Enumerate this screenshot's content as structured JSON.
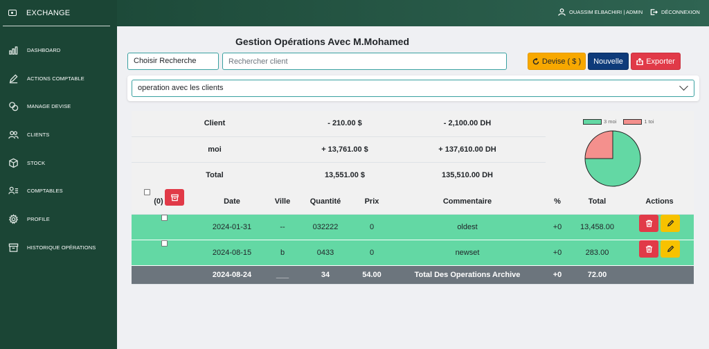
{
  "brand": {
    "title": "EXCHANGE"
  },
  "sidebar": {
    "items": [
      {
        "label": "DASHBOARD",
        "icon": "bar-chart-icon"
      },
      {
        "label": "ACTIONS COMPTABLE",
        "icon": "pencil-icon"
      },
      {
        "label": "MANAGE DEVISE",
        "icon": "coins-icon"
      },
      {
        "label": "CLIENTS",
        "icon": "users-icon"
      },
      {
        "label": "STOCK",
        "icon": "box-icon"
      },
      {
        "label": "COMPTABLES",
        "icon": "user-list-icon"
      },
      {
        "label": "PROFILE",
        "icon": "gear-icon"
      },
      {
        "label": "HISTORIQUE OPÉRATIONS",
        "icon": "archive-icon"
      }
    ]
  },
  "header": {
    "user": "OUASSIM ELBACHIRI | ADMIN",
    "logout": "DÉCONNEXION"
  },
  "page": {
    "title": "Gestion Opérations Avec M.Mohamed"
  },
  "toolbar": {
    "choice": "Choisir Recherche",
    "search_placeholder": "Rechercher client",
    "devise": "Devise ( $ )",
    "nouvelle": "Nouvelle",
    "exporter": "Exporter"
  },
  "operation_select": {
    "value": "operation avec les clients"
  },
  "summary": {
    "rows": [
      {
        "label": "Client",
        "usd": "- 210.00 $",
        "dh": "- 2,100.00 DH"
      },
      {
        "label": "moi",
        "usd": "+ 13,761.00 $",
        "dh": "+ 137,610.00 DH"
      },
      {
        "label": "Total",
        "usd": "13,551.00 $",
        "dh": "135,510.00 DH"
      }
    ]
  },
  "chart_data": {
    "type": "pie",
    "categories": [
      "3 moi",
      "1 toi"
    ],
    "values": [
      3,
      1
    ],
    "colors": [
      "#63d8a4",
      "#f4908d"
    ],
    "legend": "top"
  },
  "table": {
    "head": {
      "count": "(0)",
      "date": "Date",
      "ville": "Ville",
      "qty": "Quantité",
      "prix": "Prix",
      "comm": "Commentaire",
      "pct": "%",
      "total": "Total",
      "actions": "Actions"
    },
    "rows": [
      {
        "date": "2024-01-31",
        "ville": "--",
        "qty": "032222",
        "prix": "0",
        "comm": "oldest",
        "pct": "+0",
        "total": "13,458.00"
      },
      {
        "date": "2024-08-15",
        "ville": "b",
        "qty": "0433",
        "prix": "0",
        "comm": "newset",
        "pct": "+0",
        "total": "283.00"
      }
    ],
    "foot": {
      "date": "2024-08-24",
      "ville": "___",
      "qty": "34",
      "prix": "54.00",
      "comm": "Total Des Operations Archive",
      "pct": "+0",
      "total": "72.00"
    }
  },
  "colors": {
    "sidebar": "#1b4535",
    "row_green": "#63d8a4",
    "danger": "#e13a48",
    "warning": "#f7c200"
  }
}
